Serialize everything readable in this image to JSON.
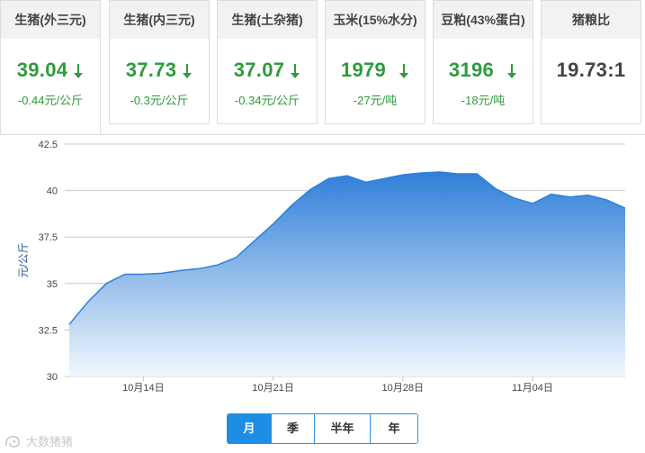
{
  "cards": [
    {
      "title": "生猪(外三元)",
      "price": "39.04",
      "change": "-0.44元/公斤",
      "direction": "down"
    },
    {
      "title": "生猪(内三元)",
      "price": "37.73",
      "change": "-0.3元/公斤",
      "direction": "down"
    },
    {
      "title": "生猪(土杂猪)",
      "price": "37.07",
      "change": "-0.34元/公斤",
      "direction": "down"
    },
    {
      "title": "玉米(15%水分)",
      "price": "1979",
      "change": "-27元/吨",
      "direction": "down"
    },
    {
      "title": "豆粕(43%蛋白)",
      "price": "3196",
      "change": "-18元/吨",
      "direction": "down"
    },
    {
      "title": "猪粮比",
      "price": "19.73:1",
      "change": "",
      "direction": "none"
    }
  ],
  "colors": {
    "down": "#2e9b3c",
    "accent": "#1e8de4",
    "area_top": "#2f7fd8",
    "area_bottom": "#f2f7fd"
  },
  "tabs": [
    {
      "label": "月",
      "active": true
    },
    {
      "label": "季",
      "active": false
    },
    {
      "label": "半年",
      "active": false
    },
    {
      "label": "年",
      "active": false
    }
  ],
  "watermark": {
    "text": "大数猪猪"
  },
  "chart_data": {
    "type": "area",
    "title": "",
    "xlabel": "",
    "ylabel": "元/公斤",
    "ylim": [
      30,
      42.5
    ],
    "yticks": [
      30,
      32.5,
      35,
      37.5,
      40,
      42.5
    ],
    "xticks": [
      {
        "day": 14,
        "label": "10月14日"
      },
      {
        "day": 21,
        "label": "10月21日"
      },
      {
        "day": 28,
        "label": "10月28日"
      },
      {
        "day": 35,
        "label": "11月04日"
      }
    ],
    "x": [
      10,
      11,
      12,
      13,
      14,
      15,
      16,
      17,
      18,
      19,
      20,
      21,
      22,
      23,
      24,
      25,
      26,
      27,
      28,
      29,
      30,
      31,
      32,
      33,
      34,
      35,
      36,
      37,
      38,
      39,
      40
    ],
    "values": [
      32.8,
      34.0,
      35.0,
      35.5,
      35.5,
      35.55,
      35.7,
      35.8,
      36.0,
      36.4,
      37.3,
      38.2,
      39.2,
      40.05,
      40.65,
      40.8,
      40.45,
      40.65,
      40.85,
      40.95,
      41.0,
      40.9,
      40.9,
      40.1,
      39.6,
      39.3,
      39.8,
      39.65,
      39.75,
      39.5,
      39.05
    ],
    "grid": true,
    "legend": "none"
  }
}
